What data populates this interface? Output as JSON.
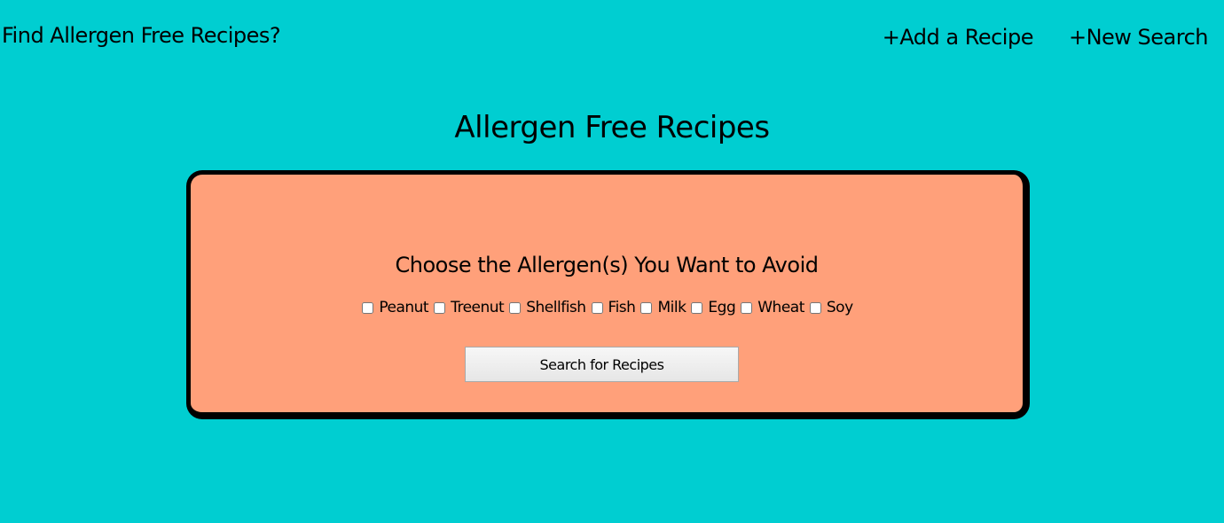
{
  "header": {
    "brand": "Find Allergen Free Recipes?",
    "nav": {
      "add_recipe": "+Add a Recipe",
      "new_search": "+New Search"
    }
  },
  "main": {
    "title": "Allergen Free Recipes",
    "panel": {
      "heading": "Choose the Allergen(s) You Want to Avoid",
      "allergens": [
        {
          "label": "Peanut",
          "checked": false
        },
        {
          "label": "Treenut",
          "checked": false
        },
        {
          "label": "Shellfish",
          "checked": false
        },
        {
          "label": "Fish",
          "checked": false
        },
        {
          "label": "Milk",
          "checked": false
        },
        {
          "label": "Egg",
          "checked": false
        },
        {
          "label": "Wheat",
          "checked": false
        },
        {
          "label": "Soy",
          "checked": false
        }
      ],
      "search_button": "Search for Recipes"
    }
  },
  "colors": {
    "background": "#00CED1",
    "panel": "#FFA07A",
    "border": "#000000"
  }
}
